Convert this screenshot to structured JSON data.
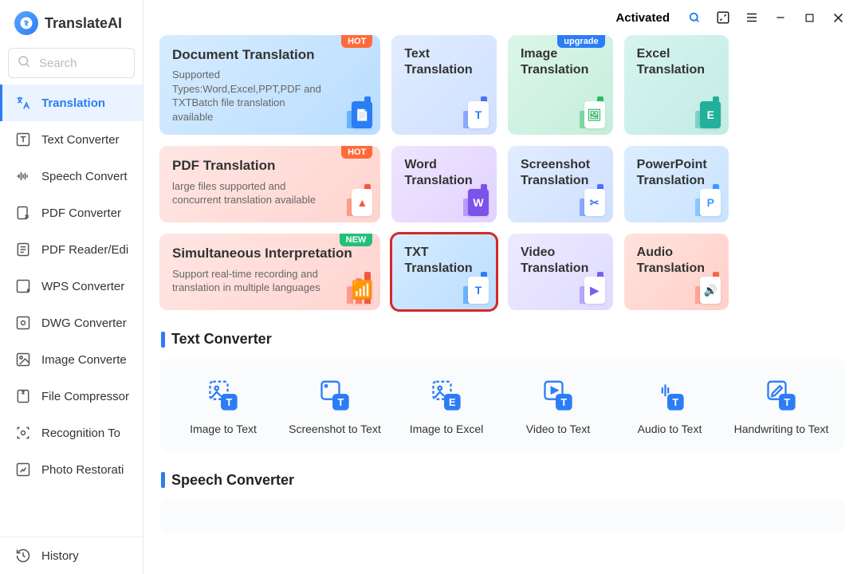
{
  "brand": {
    "name": "TranslateAI"
  },
  "search": {
    "placeholder": "Search"
  },
  "sidebar": {
    "items": [
      {
        "label": "Translation"
      },
      {
        "label": "Text Converter"
      },
      {
        "label": "Speech Convert"
      },
      {
        "label": "PDF Converter"
      },
      {
        "label": "PDF Reader/Edi"
      },
      {
        "label": "WPS Converter"
      },
      {
        "label": "DWG Converter"
      },
      {
        "label": "Image Converte"
      },
      {
        "label": "File Compressor"
      },
      {
        "label": "Recognition To"
      },
      {
        "label": "Photo Restorati"
      }
    ],
    "history": "History"
  },
  "titlebar": {
    "status": "Activated"
  },
  "badges": {
    "hot": "HOT",
    "new": "NEW",
    "upgrade": "upgrade"
  },
  "cards": {
    "doc": {
      "title": "Document Translation",
      "sub": "Supported Types:Word,Excel,PPT,PDF and TXTBatch file translation available"
    },
    "text": {
      "title": "Text Translation"
    },
    "image": {
      "title": "Image Translation"
    },
    "excel": {
      "title": "Excel Translation"
    },
    "pdf": {
      "title": "PDF Translation",
      "sub": "large files supported and concurrent translation available"
    },
    "word": {
      "title": "Word Translation"
    },
    "shot": {
      "title": "Screenshot Translation"
    },
    "ppt": {
      "title": "PowerPoint Translation"
    },
    "sim": {
      "title": "Simultaneous Interpretation",
      "sub": "Support real-time recording and translation in multiple languages"
    },
    "txt": {
      "title": "TXT Translation"
    },
    "video": {
      "title": "Video Translation"
    },
    "audio": {
      "title": "Audio Translation"
    }
  },
  "sections": {
    "textconv": "Text Converter",
    "speechconv": "Speech Converter"
  },
  "converters": [
    {
      "label": "Image to Text"
    },
    {
      "label": "Screenshot to Text"
    },
    {
      "label": "Image to Excel"
    },
    {
      "label": "Video to Text"
    },
    {
      "label": "Audio to Text"
    },
    {
      "label": "Handwriting to Text"
    }
  ]
}
